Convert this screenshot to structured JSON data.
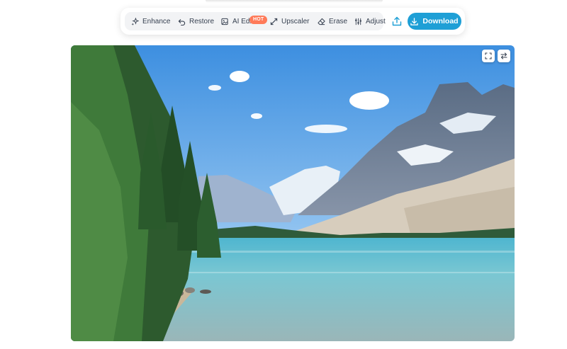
{
  "toolbar": {
    "tools": [
      {
        "label": "Enhance",
        "icon": "sparkle-icon"
      },
      {
        "label": "Restore",
        "icon": "undo-arrow-icon"
      },
      {
        "label": "AI Editor",
        "icon": "image-edit-icon",
        "badge": "HOT"
      },
      {
        "label": "Upscaler",
        "icon": "expand-arrows-icon"
      },
      {
        "label": "Erase",
        "icon": "eraser-icon"
      },
      {
        "label": "Adjust",
        "icon": "sliders-icon"
      }
    ],
    "share_icon": "upload-icon",
    "download_label": "Download",
    "download_icon": "download-icon"
  },
  "image_controls": {
    "fullscreen_icon": "fullscreen-icon",
    "compare_icon": "swap-compare-icon"
  },
  "colors": {
    "accent": "#1e9fd6",
    "badge": "#ff7a59",
    "tool_bg": "#f2f3f5",
    "text": "#374151"
  }
}
